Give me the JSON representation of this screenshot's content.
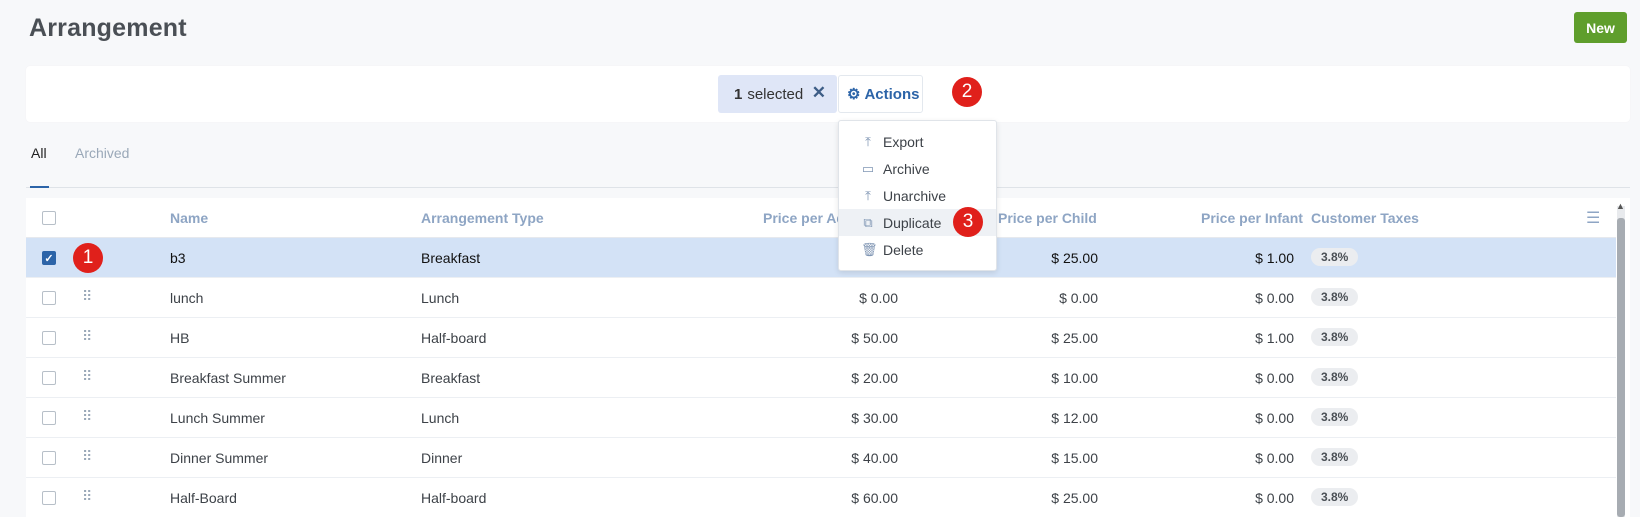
{
  "page": {
    "title": "Arrangement",
    "new_label": "New"
  },
  "selection": {
    "count": "1",
    "label": "selected",
    "clear_icon": "✕",
    "actions_label": "Actions"
  },
  "tabs": [
    {
      "label": "All"
    },
    {
      "label": "Archived"
    }
  ],
  "actions_menu": [
    {
      "label": "Export",
      "icon": "⤒"
    },
    {
      "label": "Archive",
      "icon": "▭"
    },
    {
      "label": "Unarchive",
      "icon": "⤒"
    },
    {
      "label": "Duplicate",
      "icon": "⧉"
    },
    {
      "label": "Delete",
      "icon": "🗑"
    }
  ],
  "table": {
    "columns": [
      "Name",
      "Arrangement Type",
      "Price per Adult",
      "Price per Child",
      "Price per Infant",
      "Customer Taxes"
    ],
    "rows": [
      {
        "name": "b3",
        "type": "Breakfast",
        "adult": "",
        "child": "$ 25.00",
        "infant": "$ 1.00",
        "tax": "3.8%"
      },
      {
        "name": "lunch",
        "type": "Lunch",
        "adult": "$ 0.00",
        "child": "$ 0.00",
        "infant": "$ 0.00",
        "tax": "3.8%"
      },
      {
        "name": "HB",
        "type": "Half-board",
        "adult": "$ 50.00",
        "child": "$ 25.00",
        "infant": "$ 1.00",
        "tax": "3.8%"
      },
      {
        "name": "Breakfast Summer",
        "type": "Breakfast",
        "adult": "$ 20.00",
        "child": "$ 10.00",
        "infant": "$ 0.00",
        "tax": "3.8%"
      },
      {
        "name": "Lunch Summer",
        "type": "Lunch",
        "adult": "$ 30.00",
        "child": "$ 12.00",
        "infant": "$ 0.00",
        "tax": "3.8%"
      },
      {
        "name": "Dinner Summer",
        "type": "Dinner",
        "adult": "$ 40.00",
        "child": "$ 15.00",
        "infant": "$ 0.00",
        "tax": "3.8%"
      },
      {
        "name": "Half-Board",
        "type": "Half-board",
        "adult": "$ 60.00",
        "child": "$ 25.00",
        "infant": "$ 0.00",
        "tax": "3.8%"
      }
    ]
  },
  "badges": [
    "1",
    "2",
    "3"
  ],
  "colors": {
    "accent": "#2c64a8",
    "new_button": "#5f9e2c",
    "selected_row": "#d3e2f6",
    "badge": "#e0201b"
  }
}
